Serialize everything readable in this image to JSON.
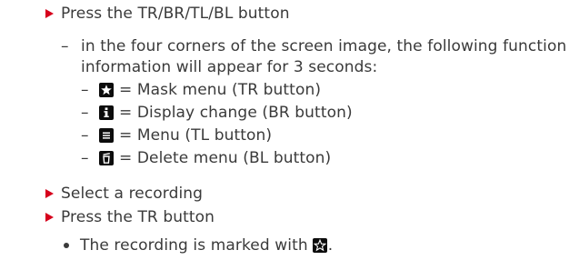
{
  "steps": {
    "press_buttons": "Press the TR/BR/TL/BL button",
    "corner_info_line1": "in the four corners of the screen image, the following function",
    "corner_info_line2": "information will appear for 3 seconds:",
    "items": [
      {
        "icon": "star-filled-icon",
        "label": "= Mask menu (TR button)"
      },
      {
        "icon": "info-icon",
        "label": "= Display change (BR button)"
      },
      {
        "icon": "menu-icon",
        "label": "= Menu (TL button)"
      },
      {
        "icon": "trash-icon",
        "label": "= Delete menu (BL button)"
      }
    ],
    "select_recording": "Select a recording",
    "press_tr": "Press the TR button",
    "result_text": "The recording is marked with",
    "result_period": "."
  },
  "colors": {
    "arrow": "#d6001c",
    "text": "#3a3a3a",
    "icon_bg": "#0c0c0c"
  }
}
